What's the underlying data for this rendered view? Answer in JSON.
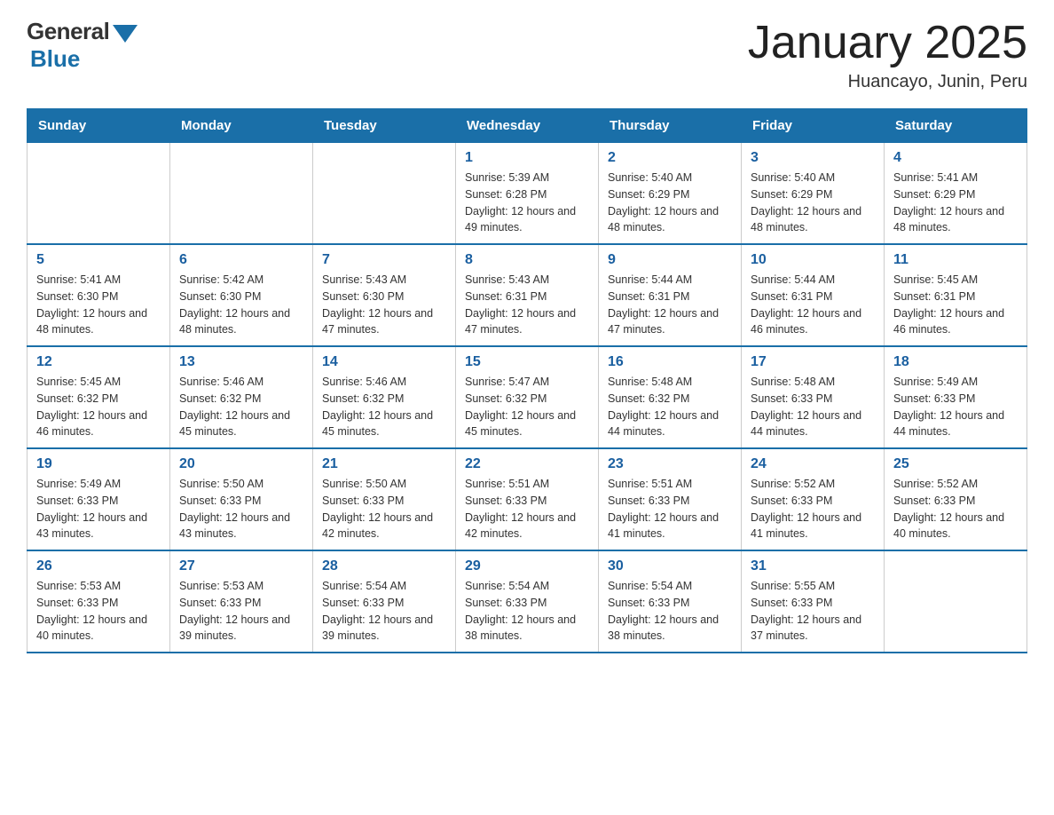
{
  "header": {
    "logo_general": "General",
    "logo_blue": "Blue",
    "title": "January 2025",
    "subtitle": "Huancayo, Junin, Peru"
  },
  "calendar": {
    "days_of_week": [
      "Sunday",
      "Monday",
      "Tuesday",
      "Wednesday",
      "Thursday",
      "Friday",
      "Saturday"
    ],
    "weeks": [
      [
        {
          "day": "",
          "info": ""
        },
        {
          "day": "",
          "info": ""
        },
        {
          "day": "",
          "info": ""
        },
        {
          "day": "1",
          "info": "Sunrise: 5:39 AM\nSunset: 6:28 PM\nDaylight: 12 hours and 49 minutes."
        },
        {
          "day": "2",
          "info": "Sunrise: 5:40 AM\nSunset: 6:29 PM\nDaylight: 12 hours and 48 minutes."
        },
        {
          "day": "3",
          "info": "Sunrise: 5:40 AM\nSunset: 6:29 PM\nDaylight: 12 hours and 48 minutes."
        },
        {
          "day": "4",
          "info": "Sunrise: 5:41 AM\nSunset: 6:29 PM\nDaylight: 12 hours and 48 minutes."
        }
      ],
      [
        {
          "day": "5",
          "info": "Sunrise: 5:41 AM\nSunset: 6:30 PM\nDaylight: 12 hours and 48 minutes."
        },
        {
          "day": "6",
          "info": "Sunrise: 5:42 AM\nSunset: 6:30 PM\nDaylight: 12 hours and 48 minutes."
        },
        {
          "day": "7",
          "info": "Sunrise: 5:43 AM\nSunset: 6:30 PM\nDaylight: 12 hours and 47 minutes."
        },
        {
          "day": "8",
          "info": "Sunrise: 5:43 AM\nSunset: 6:31 PM\nDaylight: 12 hours and 47 minutes."
        },
        {
          "day": "9",
          "info": "Sunrise: 5:44 AM\nSunset: 6:31 PM\nDaylight: 12 hours and 47 minutes."
        },
        {
          "day": "10",
          "info": "Sunrise: 5:44 AM\nSunset: 6:31 PM\nDaylight: 12 hours and 46 minutes."
        },
        {
          "day": "11",
          "info": "Sunrise: 5:45 AM\nSunset: 6:31 PM\nDaylight: 12 hours and 46 minutes."
        }
      ],
      [
        {
          "day": "12",
          "info": "Sunrise: 5:45 AM\nSunset: 6:32 PM\nDaylight: 12 hours and 46 minutes."
        },
        {
          "day": "13",
          "info": "Sunrise: 5:46 AM\nSunset: 6:32 PM\nDaylight: 12 hours and 45 minutes."
        },
        {
          "day": "14",
          "info": "Sunrise: 5:46 AM\nSunset: 6:32 PM\nDaylight: 12 hours and 45 minutes."
        },
        {
          "day": "15",
          "info": "Sunrise: 5:47 AM\nSunset: 6:32 PM\nDaylight: 12 hours and 45 minutes."
        },
        {
          "day": "16",
          "info": "Sunrise: 5:48 AM\nSunset: 6:32 PM\nDaylight: 12 hours and 44 minutes."
        },
        {
          "day": "17",
          "info": "Sunrise: 5:48 AM\nSunset: 6:33 PM\nDaylight: 12 hours and 44 minutes."
        },
        {
          "day": "18",
          "info": "Sunrise: 5:49 AM\nSunset: 6:33 PM\nDaylight: 12 hours and 44 minutes."
        }
      ],
      [
        {
          "day": "19",
          "info": "Sunrise: 5:49 AM\nSunset: 6:33 PM\nDaylight: 12 hours and 43 minutes."
        },
        {
          "day": "20",
          "info": "Sunrise: 5:50 AM\nSunset: 6:33 PM\nDaylight: 12 hours and 43 minutes."
        },
        {
          "day": "21",
          "info": "Sunrise: 5:50 AM\nSunset: 6:33 PM\nDaylight: 12 hours and 42 minutes."
        },
        {
          "day": "22",
          "info": "Sunrise: 5:51 AM\nSunset: 6:33 PM\nDaylight: 12 hours and 42 minutes."
        },
        {
          "day": "23",
          "info": "Sunrise: 5:51 AM\nSunset: 6:33 PM\nDaylight: 12 hours and 41 minutes."
        },
        {
          "day": "24",
          "info": "Sunrise: 5:52 AM\nSunset: 6:33 PM\nDaylight: 12 hours and 41 minutes."
        },
        {
          "day": "25",
          "info": "Sunrise: 5:52 AM\nSunset: 6:33 PM\nDaylight: 12 hours and 40 minutes."
        }
      ],
      [
        {
          "day": "26",
          "info": "Sunrise: 5:53 AM\nSunset: 6:33 PM\nDaylight: 12 hours and 40 minutes."
        },
        {
          "day": "27",
          "info": "Sunrise: 5:53 AM\nSunset: 6:33 PM\nDaylight: 12 hours and 39 minutes."
        },
        {
          "day": "28",
          "info": "Sunrise: 5:54 AM\nSunset: 6:33 PM\nDaylight: 12 hours and 39 minutes."
        },
        {
          "day": "29",
          "info": "Sunrise: 5:54 AM\nSunset: 6:33 PM\nDaylight: 12 hours and 38 minutes."
        },
        {
          "day": "30",
          "info": "Sunrise: 5:54 AM\nSunset: 6:33 PM\nDaylight: 12 hours and 38 minutes."
        },
        {
          "day": "31",
          "info": "Sunrise: 5:55 AM\nSunset: 6:33 PM\nDaylight: 12 hours and 37 minutes."
        },
        {
          "day": "",
          "info": ""
        }
      ]
    ]
  }
}
